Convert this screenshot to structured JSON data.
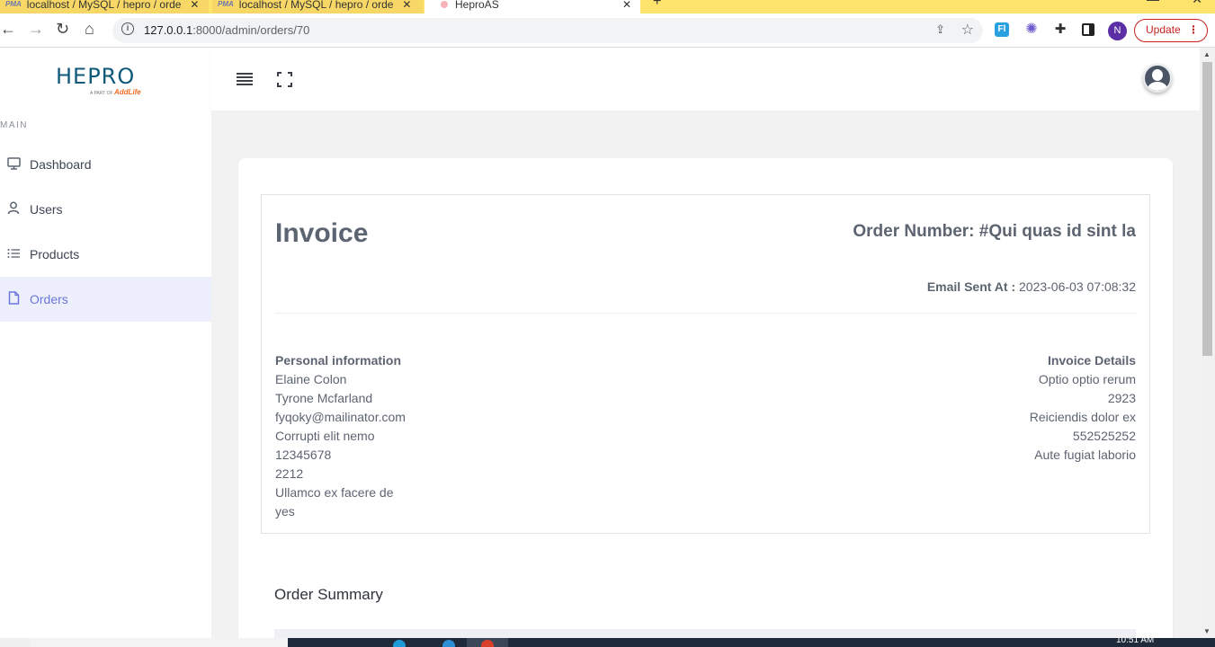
{
  "browser": {
    "tabs": [
      {
        "label": "localhost / MySQL / hepro / orde",
        "badge": "PMA"
      },
      {
        "label": "localhost / MySQL / hepro / orde",
        "badge": "PMA"
      },
      {
        "label": "HeproAS"
      }
    ],
    "url_host": "127.0.0.1",
    "url_path": ":8000/admin/orders/70",
    "profile_initial": "N",
    "update_label": "Update",
    "ext_fl_label": "Fl"
  },
  "sidebar": {
    "logo": {
      "brand": "HEPRO",
      "tagline": "A PART OF",
      "partner": "AddLife"
    },
    "section_label": "MAIN",
    "items": [
      {
        "label": "Dashboard",
        "icon": "monitor-icon"
      },
      {
        "label": "Users",
        "icon": "user-icon"
      },
      {
        "label": "Products",
        "icon": "list-icon"
      },
      {
        "label": "Orders",
        "icon": "file-icon",
        "active": true
      }
    ]
  },
  "invoice": {
    "title": "Invoice",
    "order_number": "Order Number: #Qui quas id sint la",
    "email_sent_label": "Email Sent At :",
    "email_sent_value": "2023-06-03 07:08:32",
    "personal": {
      "heading": "Personal information",
      "lines": [
        "Elaine Colon",
        "Tyrone Mcfarland",
        "fyqoky@mailinator.com",
        "Corrupti elit nemo",
        "12345678",
        "2212",
        "Ullamco ex facere de",
        "yes"
      ]
    },
    "details": {
      "heading": "Invoice Details",
      "lines": [
        "Optio optio rerum",
        "2923",
        "Reiciendis dolor ex",
        "552525252",
        "Aute fugiat laborio"
      ]
    }
  },
  "summary": {
    "title": "Order Summary"
  },
  "taskbar": {
    "clock": "10:51 AM"
  },
  "colors": {
    "accent": "#6a76d9",
    "active_bg": "#edf0fc",
    "brand": "#0f5a7a",
    "update": "#c5221f"
  }
}
